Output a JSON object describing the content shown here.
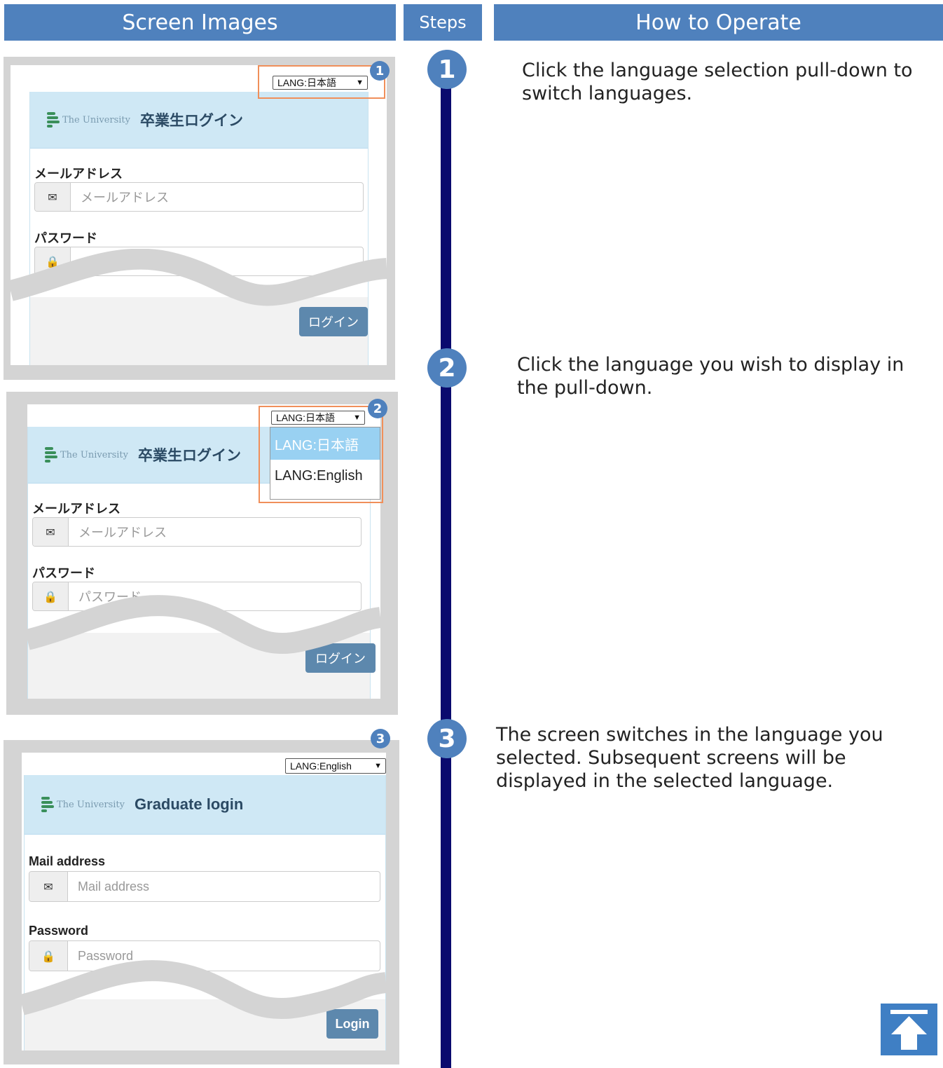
{
  "headers": {
    "screen_images": "Screen Images",
    "steps": "Steps",
    "how_to_operate": "How to Operate"
  },
  "steps": [
    {
      "number": "1",
      "description": "Click the language selection pull-down to switch languages."
    },
    {
      "number": "2",
      "description": "Click the language you wish to display in the pull-down."
    },
    {
      "number": "3",
      "description": "The screen switches in the language you selected. Subsequent screens will be displayed in the selected language."
    }
  ],
  "screens": {
    "ja": {
      "lang_select": "LANG:日本語",
      "logo_text": "The University",
      "title": "卒業生ログイン",
      "email_label": "メールアドレス",
      "email_placeholder": "メールアドレス",
      "password_label": "パスワード",
      "password_placeholder": "パスワード",
      "login_button": "ログイン"
    },
    "dropdown": {
      "options": [
        "LANG:日本語",
        "LANG:English"
      ],
      "selected": "LANG:日本語"
    },
    "en": {
      "lang_select": "LANG:English",
      "logo_text": "The University",
      "title": "Graduate login",
      "email_label": "Mail address",
      "email_placeholder": "Mail address",
      "password_label": "Password",
      "password_placeholder": "Password",
      "login_button": "Login"
    }
  },
  "badges": [
    "1",
    "2",
    "3"
  ],
  "colors": {
    "header_blue": "#4f81bd",
    "timeline_navy": "#0a0a6e",
    "highlight_orange": "#f08f5a",
    "card_header": "#cfe8f5",
    "login_button": "#5d88ad",
    "dropdown_selected": "#99d1f2"
  },
  "icons": {
    "email": "envelope-icon",
    "password": "lock-icon",
    "dropdown": "chevron-down-icon",
    "back_to_top": "arrow-up-icon"
  }
}
